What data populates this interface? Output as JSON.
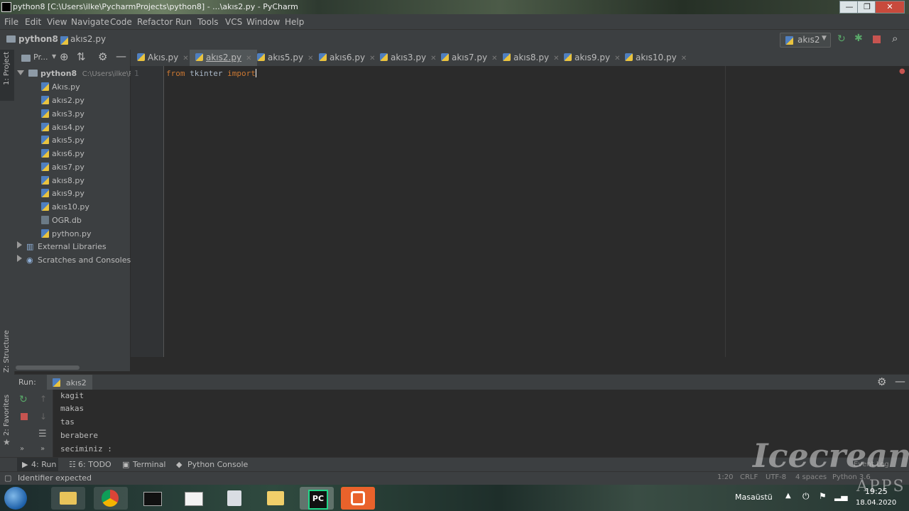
{
  "window": {
    "title": "python8 [C:\\Users\\ilke\\PycharmProjects\\python8] - ...\\akıs2.py - PyCharm",
    "minimize": "—",
    "maximize": "❐",
    "close": "✕"
  },
  "menu": [
    "File",
    "Edit",
    "View",
    "Navigate",
    "Code",
    "Refactor",
    "Run",
    "Tools",
    "VCS",
    "Window",
    "Help"
  ],
  "breadcrumb": {
    "project": "python8",
    "file": "akıs2.py"
  },
  "run_config": {
    "label": "akıs2"
  },
  "project_panel": {
    "label": "Pr...",
    "root": {
      "name": "python8",
      "path": "C:\\Users\\ilke\\Py"
    },
    "files": [
      "Akıs.py",
      "akıs2.py",
      "akıs3.py",
      "akıs4.py",
      "akıs5.py",
      "akıs6.py",
      "akıs7.py",
      "akıs8.py",
      "akıs9.py",
      "akıs10.py",
      "OGR.db",
      "python.py"
    ],
    "external": "External Libraries",
    "scratches": "Scratches and Consoles"
  },
  "tabs": [
    "Akıs.py",
    "akıs2.py",
    "akıs5.py",
    "akıs6.py",
    "akıs3.py",
    "akıs7.py",
    "akıs8.py",
    "akıs9.py",
    "akıs10.py"
  ],
  "editor": {
    "line_number": "1",
    "kw1": "from",
    "module": "tkinter",
    "kw2": "import"
  },
  "left_strip": {
    "project": "1: Project",
    "structure": "Z: Structure",
    "favorites": "2: Favorites"
  },
  "run_panel": {
    "label": "Run:",
    "config": "akıs2",
    "output": [
      "kagit",
      "makas",
      "tas",
      "berabere",
      "seciminiz :"
    ]
  },
  "tool_tabs": {
    "run": "4: Run",
    "todo": "6: TODO",
    "terminal": "Terminal",
    "python_console": "Python Console"
  },
  "status": {
    "message": "Identifier expected",
    "position": "1:20",
    "line_sep": "CRLF",
    "encoding": "UTF-8",
    "indent": "4 spaces",
    "interpreter": "Python 3.6",
    "event_log": "Event Log"
  },
  "taskbar": {
    "desktop": "Masaüstü",
    "time": "19:25",
    "date": "18.04.2020"
  },
  "watermark": {
    "brand": "Icecream",
    "sub": "APPS"
  }
}
